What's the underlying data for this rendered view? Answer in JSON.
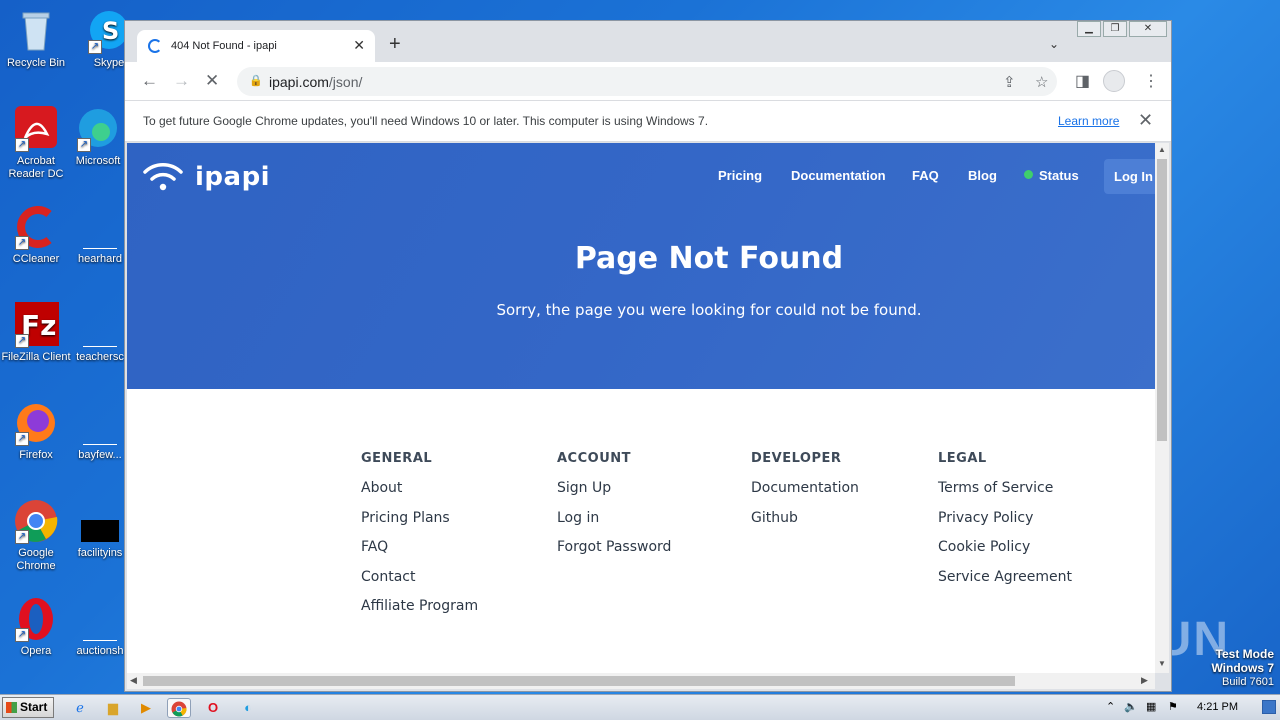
{
  "desktop": {
    "icons": [
      {
        "label": "Recycle Bin"
      },
      {
        "label": "Skype"
      },
      {
        "label": "Acrobat Reader DC"
      },
      {
        "label": "Microsoft"
      },
      {
        "label": "CCleaner"
      },
      {
        "label": "hearhard"
      },
      {
        "label": "FileZilla Client"
      },
      {
        "label": "teachersc"
      },
      {
        "label": "Firefox"
      },
      {
        "label": "bayfew..."
      },
      {
        "label": "Google Chrome"
      },
      {
        "label": "facilityins"
      },
      {
        "label": "Opera"
      },
      {
        "label": "auctionsh"
      }
    ],
    "watermark": "ANY RUN",
    "testmode": {
      "line1": "Test Mode",
      "line2": "Windows 7",
      "line3": "Build 7601"
    }
  },
  "taskbar": {
    "start_label": "Start",
    "clock": "4:21 PM"
  },
  "browser": {
    "tab": {
      "title": "404 Not Found - ipapi"
    },
    "address": {
      "host": "ipapi.com",
      "path": "/json/"
    },
    "infobar": {
      "message": "To get future Google Chrome updates, you'll need Windows 10 or later. This computer is using Windows 7.",
      "link": "Learn more"
    }
  },
  "page": {
    "brand": "ipapi",
    "nav": {
      "pricing": "Pricing",
      "documentation": "Documentation",
      "faq": "FAQ",
      "blog": "Blog",
      "status": "Status",
      "login": "Log In"
    },
    "hero": {
      "title": "Page Not Found",
      "subtitle": "Sorry, the page you were looking for could not be found."
    },
    "footer": {
      "general": {
        "heading": "GENERAL",
        "links": [
          "About",
          "Pricing Plans",
          "FAQ",
          "Contact",
          "Affiliate Program"
        ]
      },
      "account": {
        "heading": "ACCOUNT",
        "links": [
          "Sign Up",
          "Log in",
          "Forgot Password"
        ]
      },
      "developer": {
        "heading": "DEVELOPER",
        "links": [
          "Documentation",
          "Github"
        ]
      },
      "legal": {
        "heading": "LEGAL",
        "links": [
          "Terms of Service",
          "Privacy Policy",
          "Cookie Policy",
          "Service Agreement"
        ]
      }
    }
  },
  "colors": {
    "hero_blue": "#3467c7",
    "status_green": "#3fcf6c",
    "link_blue": "#1a73e8"
  }
}
